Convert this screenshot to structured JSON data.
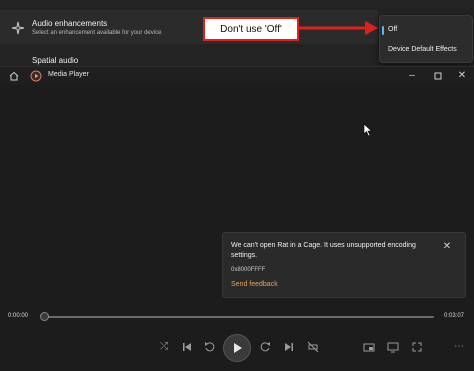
{
  "settings": {
    "audio_enhancements": {
      "title": "Audio enhancements",
      "subtitle": "Select an enhancement available for your device"
    },
    "spatial_audio_title": "Spatial audio",
    "dropdown": {
      "options": [
        "Off",
        "Device Default Effects"
      ],
      "selected": "Off"
    }
  },
  "annotation": {
    "text": "Don't use 'Off'",
    "color": "#e0211b"
  },
  "player": {
    "title": "Media Player",
    "toast": {
      "message": "We can't open Rat in a Cage. It uses unsupported encoding settings.",
      "code": "0x8000FFFF",
      "link": "Send feedback"
    },
    "time_current": "0:00:00",
    "time_total": "0:03:07",
    "progress": 0
  },
  "colors": {
    "accent": "#5ab4ff",
    "link": "#e8a15a"
  }
}
